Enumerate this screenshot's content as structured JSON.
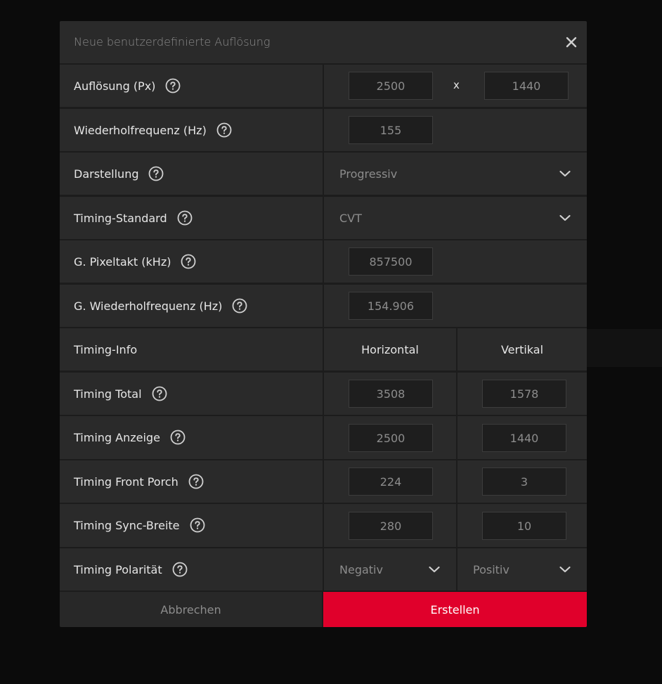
{
  "dialog": {
    "title": "Neue benutzerdefinierte Auflösung",
    "close_icon": "close-icon"
  },
  "rows": {
    "resolution": {
      "label": "Auflösung (Px)",
      "width": "2500",
      "separator": "x",
      "height": "1440"
    },
    "refresh": {
      "label": "Wiederholfrequenz (Hz)",
      "value": "155"
    },
    "display": {
      "label": "Darstellung",
      "value": "Progressiv"
    },
    "timing_standard": {
      "label": "Timing-Standard",
      "value": "CVT"
    },
    "pixel_clock": {
      "label": "G. Pixeltakt (kHz)",
      "value": "857500"
    },
    "g_refresh": {
      "label": "G. Wiederholfrequenz (Hz)",
      "value": "154.906"
    },
    "timing_info": {
      "label": "Timing-Info",
      "horizontal": "Horizontal",
      "vertical": "Vertikal"
    },
    "timing_total": {
      "label": "Timing Total",
      "h": "3508",
      "v": "1578"
    },
    "timing_display": {
      "label": "Timing Anzeige",
      "h": "2500",
      "v": "1440"
    },
    "timing_front_porch": {
      "label": "Timing Front Porch",
      "h": "224",
      "v": "3"
    },
    "timing_sync_width": {
      "label": "Timing Sync-Breite",
      "h": "280",
      "v": "10"
    },
    "timing_polarity": {
      "label": "Timing Polarität",
      "h": "Negativ",
      "v": "Positiv"
    }
  },
  "footer": {
    "cancel_label": "Abbrechen",
    "create_label": "Erstellen"
  },
  "colors": {
    "accent": "#e0002b",
    "panel": "#2a2a2a",
    "background": "#0b0b0b"
  }
}
